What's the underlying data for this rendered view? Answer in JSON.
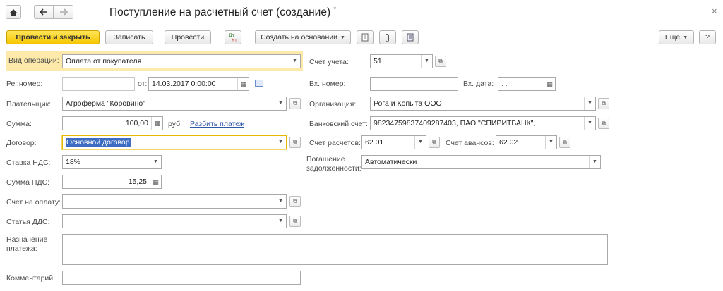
{
  "window": {
    "title": "Поступление на расчетный счет (создание)",
    "modified_mark": "*",
    "close_icon": "close-icon"
  },
  "nav": {
    "home_icon": "home-icon",
    "back_icon": "back-arrow-icon",
    "forward_icon": "forward-arrow-icon"
  },
  "toolbar": {
    "post_close": "Провести и закрыть",
    "save": "Записать",
    "post": "Провести",
    "create_based": "Создать на основании",
    "more": "Еще",
    "help": "?",
    "dtkt_icon": "debit-credit-icon",
    "print_icon": "document-icon",
    "attach_icon": "paperclip-icon",
    "report_icon": "report-icon"
  },
  "form": {
    "operation_type": {
      "label": "Вид операции:",
      "value": "Оплата от покупателя"
    },
    "reg_number": {
      "label": "Рег.номер:",
      "value": ""
    },
    "date": {
      "label": "от:",
      "value": "14.03.2017  0:00:00"
    },
    "payer": {
      "label": "Плательщик:",
      "value": "Агроферма \"Коровино\""
    },
    "amount": {
      "label": "Сумма:",
      "value": "100,00",
      "unit": "руб.",
      "split_link": "Разбить платеж"
    },
    "contract": {
      "label": "Договор:",
      "value": "Основной договор"
    },
    "vat_rate": {
      "label": "Ставка НДС:",
      "value": "18%"
    },
    "vat_amount": {
      "label": "Сумма НДС:",
      "value": "15,25"
    },
    "invoice": {
      "label": "Счет на оплату:",
      "value": ""
    },
    "cash_flow_item": {
      "label": "Статья ДДС:",
      "value": ""
    },
    "purpose": {
      "label": "Назначение платежа:",
      "value": ""
    },
    "comment": {
      "label": "Комментарий:",
      "value": ""
    },
    "account": {
      "label": "Счет учета:",
      "value": "51"
    },
    "in_number": {
      "label": "Вх. номер:",
      "value": ""
    },
    "in_date": {
      "label": "Вх. дата:",
      "value": " .  ."
    },
    "organization": {
      "label": "Организация:",
      "value": "Рога и Копыта ООО"
    },
    "bank_account": {
      "label": "Банковский счет:",
      "value": "98234759837409287403, ПАО \"СПИРИТБАНК\","
    },
    "settlement_account": {
      "label": "Счет расчетов:",
      "value": "62.01"
    },
    "advance_account": {
      "label": "Счет авансов:",
      "value": "62.02"
    },
    "debt_repayment": {
      "label_line1": "Погашение",
      "label_line2": "задолженности:",
      "value": "Автоматически"
    }
  },
  "colors": {
    "primary_button": "#f5c600",
    "highlight_row": "#fdeaaa",
    "link": "#2f58a7",
    "selection": "#3d6cc3"
  }
}
